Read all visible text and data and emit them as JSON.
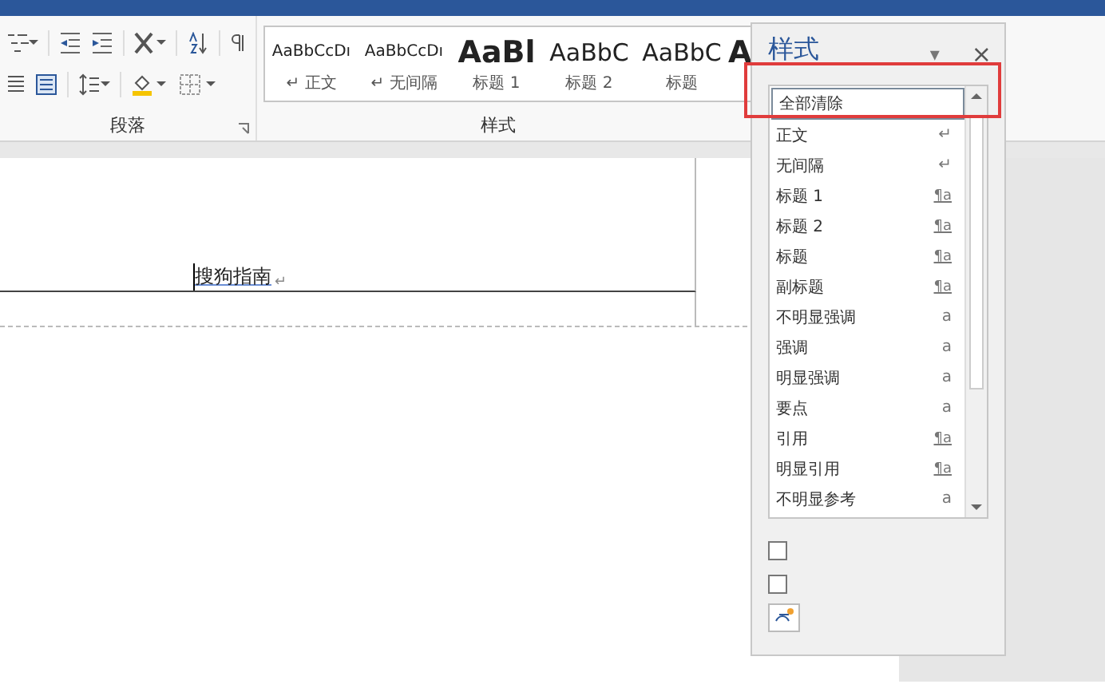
{
  "ribbon": {
    "groups": [
      {
        "label": "段落"
      },
      {
        "label": "样式"
      }
    ],
    "gallery": [
      {
        "preview": "AaBbCcDı",
        "label": "正文",
        "kind": "normal",
        "mark": "↵"
      },
      {
        "preview": "AaBbCcDı",
        "label": "无间隔",
        "kind": "normal",
        "mark": "↵"
      },
      {
        "preview": "AaBl",
        "label": "标题 1",
        "kind": "heading1"
      },
      {
        "preview": "AaBbC",
        "label": "标题 2",
        "kind": "heading2"
      },
      {
        "preview": "AaBbC",
        "label": "标题",
        "kind": "title"
      },
      {
        "preview": "A",
        "kind": "cut"
      }
    ]
  },
  "document": {
    "text": "搜狗指南",
    "mark": "↵"
  },
  "styles_pane": {
    "title": "样式",
    "menu": "▾",
    "close": "×",
    "items": [
      {
        "label": "全部清除",
        "selected": true
      },
      {
        "label": "正文",
        "mark": "↵",
        "kind": "paragraph",
        "selected": false
      },
      {
        "label": "无间隔",
        "mark": "↵",
        "kind": "paragraph",
        "selected": false
      },
      {
        "label": "标题 1",
        "mark": "¶a",
        "kind": "linked",
        "selected": false
      },
      {
        "label": "标题 2",
        "mark": "¶a",
        "kind": "linked",
        "selected": false
      },
      {
        "label": "标题",
        "mark": "¶a",
        "kind": "linked",
        "selected": false
      },
      {
        "label": "副标题",
        "mark": "¶a",
        "kind": "linked",
        "selected": false
      },
      {
        "label": "不明显强调",
        "mark": "a",
        "kind": "character",
        "selected": false
      },
      {
        "label": "强调",
        "mark": "a",
        "kind": "character",
        "selected": false
      },
      {
        "label": "明显强调",
        "mark": "a",
        "kind": "character",
        "selected": false
      },
      {
        "label": "要点",
        "mark": "a",
        "kind": "character",
        "selected": false
      },
      {
        "label": "引用",
        "mark": "¶a",
        "kind": "linked",
        "selected": false
      },
      {
        "label": "明显引用",
        "mark": "¶a",
        "kind": "linked",
        "selected": false
      },
      {
        "label": "不明显参考",
        "mark": "a",
        "kind": "character",
        "selected": false
      }
    ],
    "options": [
      {
        "checked": false
      },
      {
        "checked": false
      }
    ]
  }
}
